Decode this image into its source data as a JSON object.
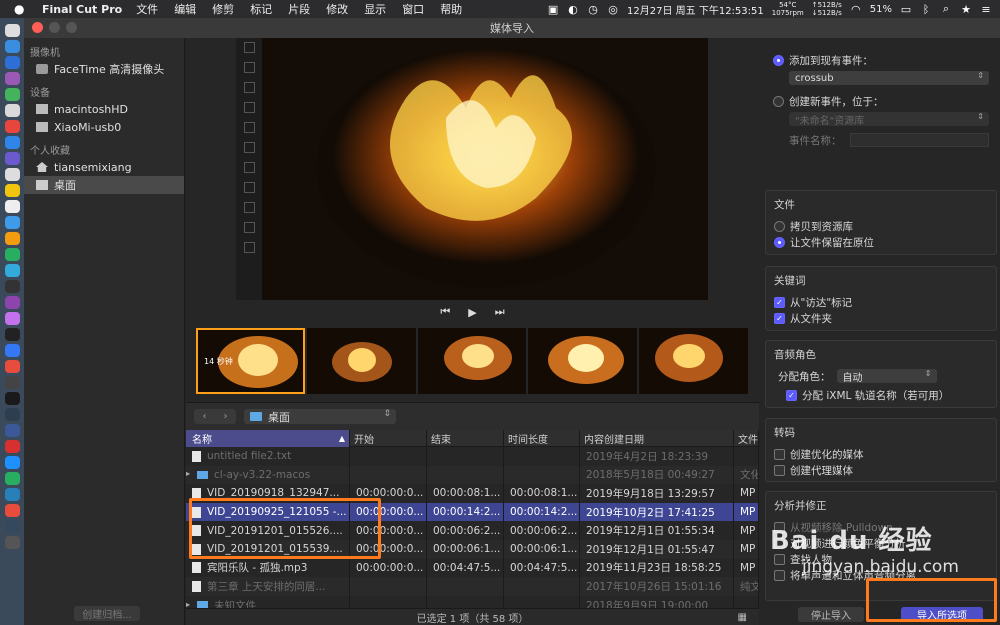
{
  "menubar": {
    "app_name": "Final Cut Pro",
    "items": [
      "文件",
      "编辑",
      "修剪",
      "标记",
      "片段",
      "修改",
      "显示",
      "窗口",
      "帮助"
    ],
    "temp": "54°C",
    "fan": "1075rpm",
    "net_up": "↑512B/s",
    "net_down": "↓512B/s",
    "datetime": "12月27日 周五 下午12:53:51",
    "battery": "51%"
  },
  "window": {
    "title": "媒体导入"
  },
  "sidebar": {
    "sections": [
      {
        "title": "摄像机",
        "items": [
          {
            "label": "FaceTime 高清摄像头"
          }
        ]
      },
      {
        "title": "设备",
        "items": [
          {
            "label": "macintoshHD"
          },
          {
            "label": "XiaoMi-usb0"
          }
        ]
      },
      {
        "title": "个人收藏",
        "items": [
          {
            "label": "tiansemixiang"
          },
          {
            "label": "桌面",
            "selected": true
          }
        ]
      }
    ],
    "create_archive": "创建归档..."
  },
  "viewer": {
    "thumb_duration": "14 秒钟"
  },
  "browser": {
    "path": "桌面",
    "columns": [
      "名称",
      "开始",
      "结束",
      "时间长度",
      "内容创建日期",
      "文件"
    ],
    "rows": [
      {
        "name": "untitled file2.txt",
        "start": "",
        "end": "",
        "dur": "",
        "date": "2019年4月2日 18:23:39",
        "type": "",
        "kind": "file",
        "style": "dim"
      },
      {
        "name": "cl-ay-v3.22-macos",
        "start": "",
        "end": "",
        "dur": "",
        "date": "2018年5月18日 00:49:27",
        "type": "文化",
        "kind": "folder",
        "style": "dim"
      },
      {
        "name": "VID_20190918_132947...",
        "start": "00:00:00:0...",
        "end": "00:00:08:1...",
        "dur": "00:00:08:1...",
        "date": "2019年9月18日 13:29:57",
        "type": "MP",
        "kind": "file",
        "style": ""
      },
      {
        "name": "VID_20190925_121055 -...",
        "start": "00:00:00:0...",
        "end": "00:00:14:2...",
        "dur": "00:00:14:2...",
        "date": "2019年10月2日 17:41:25",
        "type": "MP",
        "kind": "file",
        "style": "sel"
      },
      {
        "name": "VID_20191201_015526....",
        "start": "00:00:00:0...",
        "end": "00:00:06:2...",
        "dur": "00:00:06:2...",
        "date": "2019年12月1日 01:55:34",
        "type": "MP",
        "kind": "file",
        "style": ""
      },
      {
        "name": "VID_20191201_015539....",
        "start": "00:00:00:0...",
        "end": "00:00:06:1...",
        "dur": "00:00:06:1...",
        "date": "2019年12月1日 01:55:47",
        "type": "MP",
        "kind": "file",
        "style": ""
      },
      {
        "name": "宾阳乐队 - 孤独.mp3",
        "start": "00:00:00:0...",
        "end": "00:04:47:5...",
        "dur": "00:04:47:5...",
        "date": "2019年11月23日 18:58:25",
        "type": "MP",
        "kind": "file",
        "style": ""
      },
      {
        "name": "第三章 上天安排的同居...",
        "start": "",
        "end": "",
        "dur": "",
        "date": "2017年10月26日 15:01:16",
        "type": "纯文",
        "kind": "file",
        "style": "dim"
      },
      {
        "name": "未知文件",
        "start": "",
        "end": "",
        "dur": "",
        "date": "2018年9月9日 19:00:00",
        "type": "",
        "kind": "folder",
        "style": "dim"
      }
    ],
    "status": "已选定 1 项（共 58 项）"
  },
  "import_options": {
    "add_to_existing": "添加到现有事件：",
    "existing_event": "crossub",
    "create_new": "创建新事件，位于：",
    "library_placeholder": "\"未命名\"资源库",
    "event_name_label": "事件名称：",
    "files_title": "文件",
    "copy_to_library": "拷贝到资源库",
    "leave_in_place": "让文件保留在原位",
    "keywords_title": "关键词",
    "from_finder_tags": "从\"访达\"标记",
    "from_folders": "从文件夹",
    "audio_roles_title": "音频角色",
    "assign_roles_label": "分配角色：",
    "assign_roles_value": "自动",
    "assign_ixml": "分配 iXML 轨道名称（若可用）",
    "transcode_title": "转码",
    "create_optimized": "创建优化的媒体",
    "create_proxy": "创建代理媒体",
    "analyze_title": "分析并修正",
    "remove_pulldown": "从视频移除 Pulldown",
    "analyze_balance": "对视频进行颜色平衡分析",
    "find_people": "查找人物",
    "separate_mono": "将单声道和立体声音频分离",
    "stop_import": "停止导入",
    "import_selected": "导入所选项"
  },
  "watermark": {
    "logo": "Bai du 经验",
    "url": "jingyan.baidu.com"
  },
  "colors": {
    "accent": "#5b5bff",
    "selection": "#3e4694",
    "annotation": "#ff7a1a",
    "import_button": "#4e4ec8"
  }
}
